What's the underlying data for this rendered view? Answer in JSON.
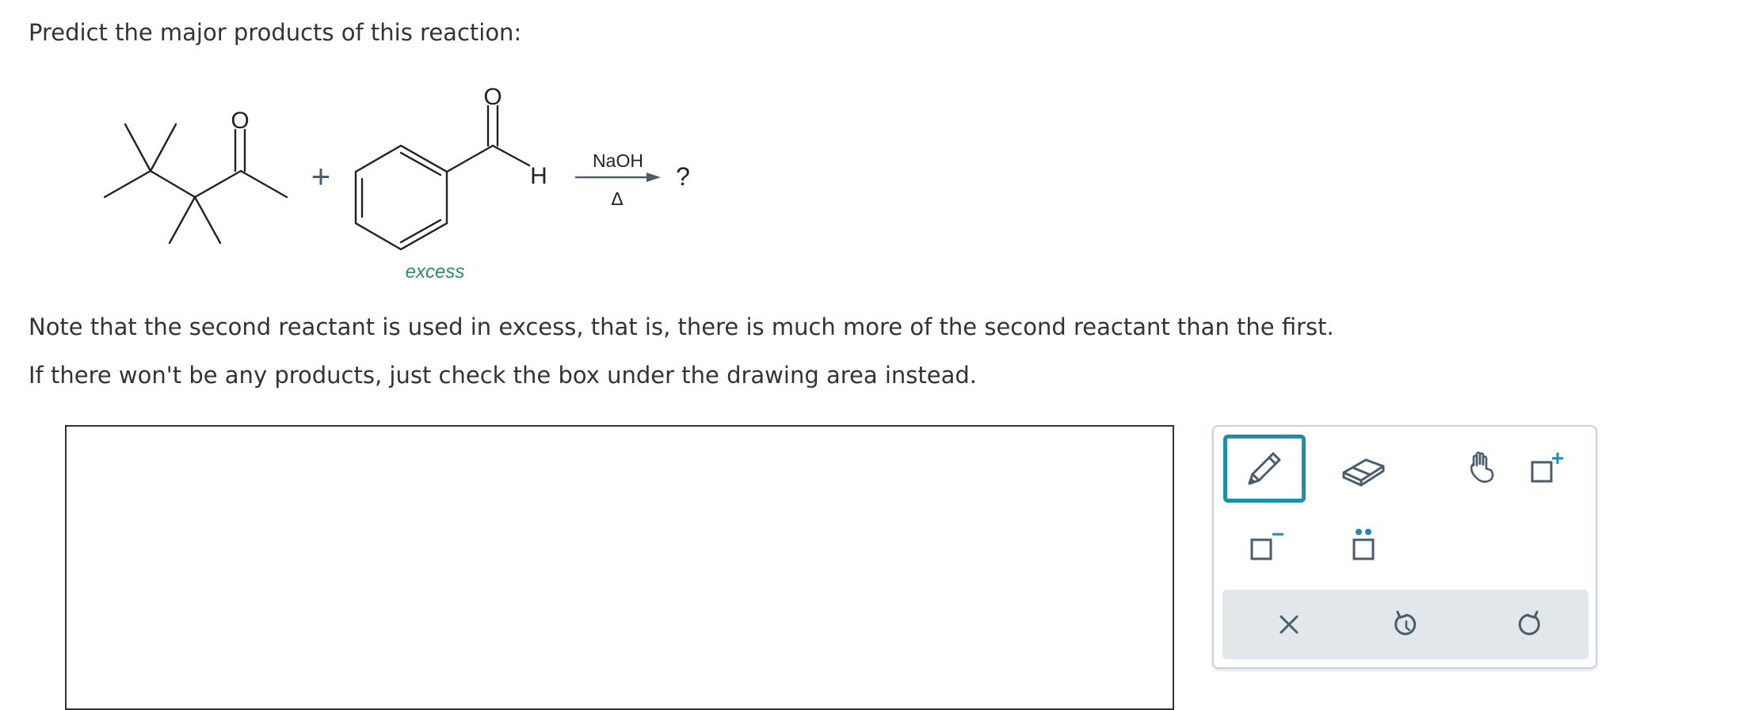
{
  "question": {
    "prompt": "Predict the major products of this reaction:",
    "reactant_2_note": "excess",
    "reagent_top": "NaOH",
    "reagent_bottom": "Δ",
    "product_placeholder": "?",
    "plus": "+",
    "oxygen_label": "O",
    "hydrogen_label": "H"
  },
  "notes": {
    "line1": "Note that the second reactant is used in excess, that is, there is much more of the second reactant than the first.",
    "line2": "If there won't be any products, just check the box under the drawing area instead."
  },
  "toolbox": {
    "tools": [
      {
        "name": "pencil",
        "selected": true
      },
      {
        "name": "eraser",
        "selected": false
      },
      {
        "name": "hand",
        "selected": false
      },
      {
        "name": "add-charge-positive",
        "selected": false
      },
      {
        "name": "add-charge-negative",
        "selected": false
      },
      {
        "name": "lone-pair",
        "selected": false
      }
    ],
    "actions": [
      "clear",
      "undo",
      "redo"
    ]
  },
  "colors": {
    "text": "#333333",
    "accent": "#1a8fb0",
    "excess_green": "#2e8b57",
    "arrow": "#4a5d6a"
  }
}
